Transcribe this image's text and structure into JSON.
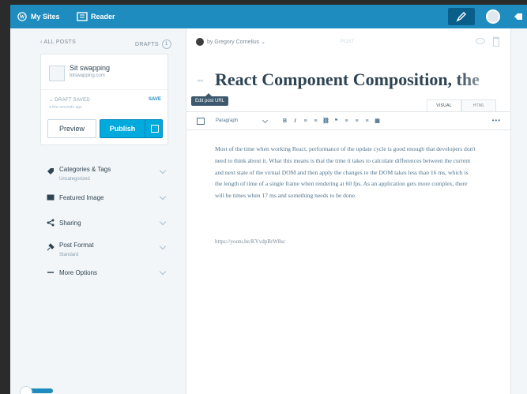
{
  "masterbar": {
    "my_sites_label": "My Sites",
    "reader_label": "Reader",
    "icons": [
      "wordpress-icon",
      "reader-icon",
      "write-icon",
      "avatar",
      "notifications-icon"
    ],
    "colors": {
      "bar": "#1e8cbe",
      "write_active": "#0a5f8a"
    }
  },
  "sidebar": {
    "back_label": "ALL POSTS",
    "drafts_label": "DRAFTS",
    "drafts_count": "1",
    "site": {
      "name": "Sit swapping",
      "url": "bitswapping.com"
    },
    "save_status": "DRAFT SAVED",
    "save_sub": "a few seconds ago",
    "save_link": "SAVE",
    "preview_label": "Preview",
    "publish_label": "Publish",
    "items": [
      {
        "label": "Categories & Tags",
        "sub": "Uncategorized",
        "icon": "tag-icon"
      },
      {
        "label": "Featured Image",
        "sub": "",
        "icon": "image-icon"
      },
      {
        "label": "Sharing",
        "sub": "",
        "icon": "share-icon"
      },
      {
        "label": "Post Format",
        "sub": "Standard",
        "icon": "pin-icon"
      },
      {
        "label": "More Options",
        "sub": "",
        "icon": "dash-icon"
      }
    ],
    "colors": {
      "publish": "#00aadc"
    }
  },
  "editor": {
    "author": "by Gregory Cornelius",
    "status": "POST",
    "title_icon": "link-icon",
    "title": "React Component Composition, the",
    "tooltip": "Edit post URL",
    "tabs": [
      "VISUAL",
      "HTML"
    ],
    "format": "Paragraph",
    "toolbar_buttons": [
      "B",
      "I",
      "≡",
      "≡",
      "⛓",
      "❝",
      "≡",
      "≡",
      "≡",
      "▦"
    ],
    "more": "•••",
    "body": "Most of the time when working React, performance of the update cycle is good enough that developers don't need to think about it. What this means is that the time it takes to calculate differences between the current and next state of the virtual DOM and then apply the changes to the DOM takes less than 16 ms, which is the length of time of a single frame when rendering at 60 fps. As an application gets more complex, there will be times when 17 ms and something needs to be done.",
    "link": "https://youtu.be/KVvdpBrW8sc"
  }
}
